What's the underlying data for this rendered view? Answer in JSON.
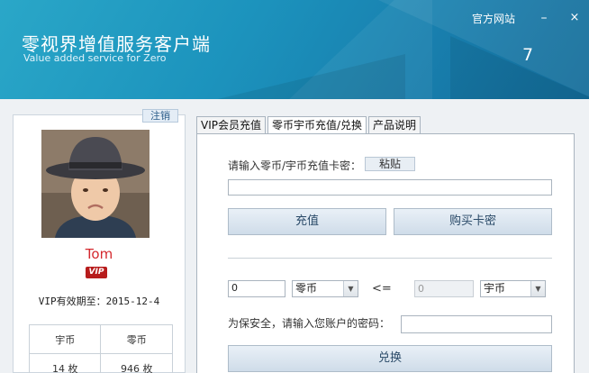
{
  "header": {
    "title_cn": "零视界增值服务客户端",
    "title_en": "Value added service for Zero",
    "site_link": "官方网站",
    "minimize_label": "–",
    "close_label": "×",
    "number": "7"
  },
  "user": {
    "logout_label": "注销",
    "username": "Tom",
    "vip_badge": "VIP",
    "vip_expiry": "VIP有效期至：2015-12-4",
    "coins": {
      "col1_header": "宇币",
      "col2_header": "零币",
      "col1_value": "14 枚",
      "col2_value": "946 枚"
    }
  },
  "tabs": [
    {
      "label": "VIP会员充值"
    },
    {
      "label": "零币宇币充值/兑换"
    },
    {
      "label": "产品说明"
    }
  ],
  "recharge": {
    "prompt": "请输入零币/宇币充值卡密：",
    "paste_label": "粘贴",
    "card_value": "",
    "recharge_label": "充值",
    "buy_label": "购买卡密"
  },
  "exchange": {
    "amount_value": "0",
    "from_currency": "零币",
    "arrow": "<=",
    "result_value": "0",
    "to_currency": "宇币",
    "password_prompt": "为保安全，请输入您账户的密码：",
    "password_value": "",
    "exchange_label": "兑换"
  }
}
